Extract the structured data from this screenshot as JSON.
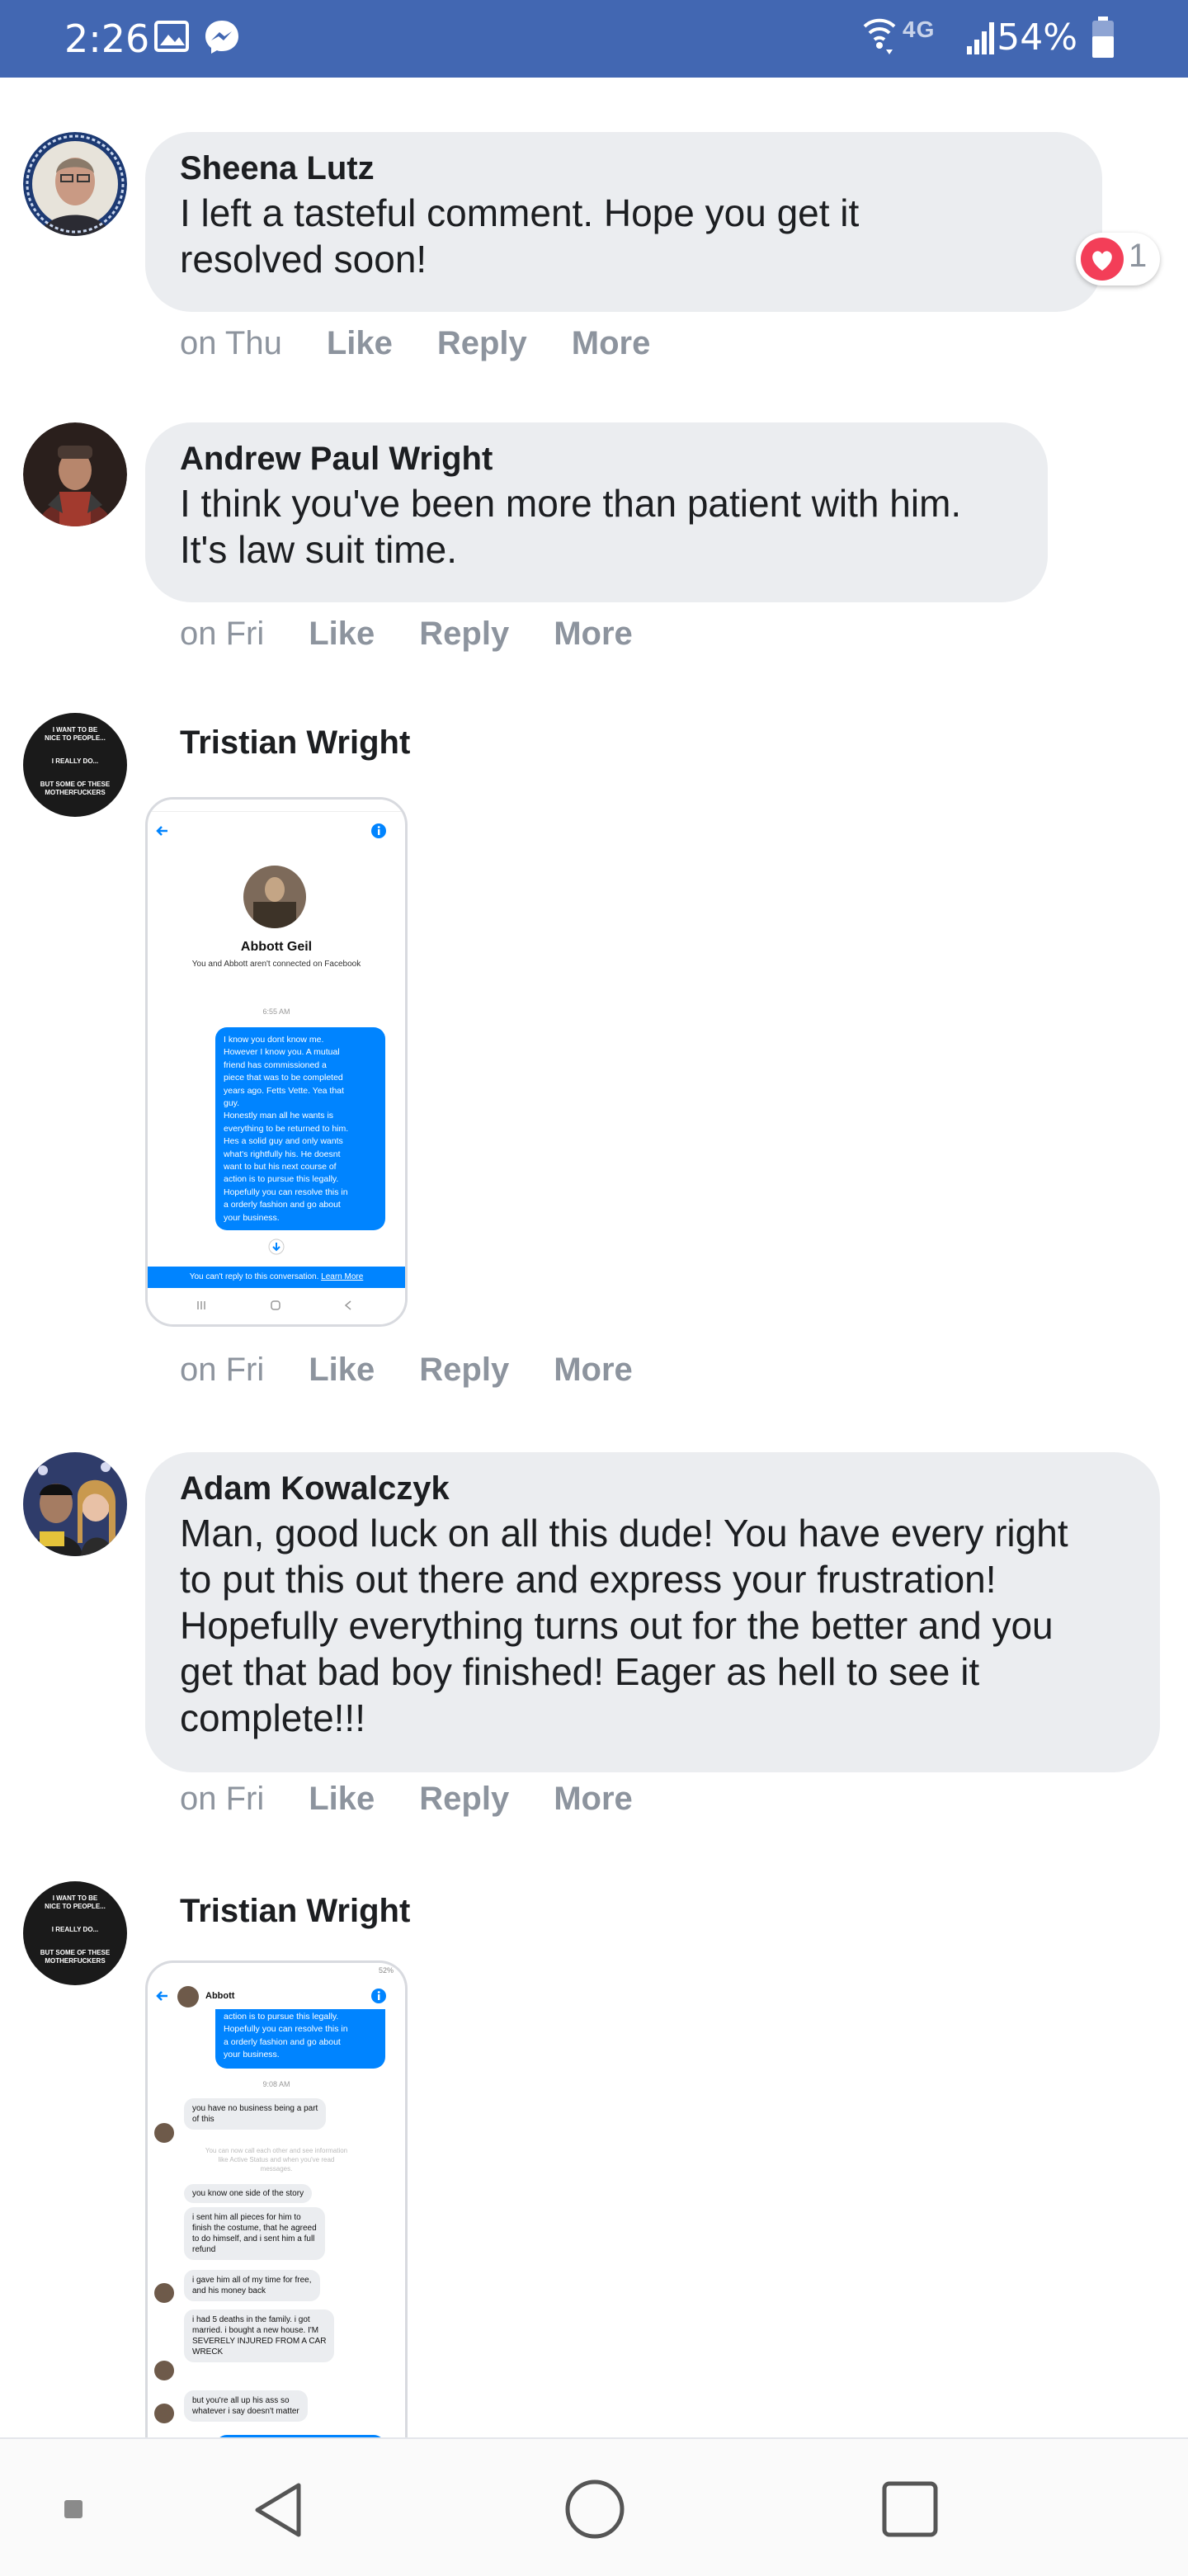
{
  "status_bar": {
    "time": "2:26",
    "network": "4G",
    "battery": "54%"
  },
  "comments": [
    {
      "name": "Sheena Lutz",
      "text": [
        "I left a tasteful comment. Hope you get it",
        "resolved soon!"
      ],
      "time": "on Thu",
      "like": "Like",
      "reply": "Reply",
      "more": "More",
      "reaction_count": "1"
    },
    {
      "name": "Andrew Paul Wright",
      "text": [
        "I think you've been more than patient with him.",
        "It's law suit time."
      ],
      "time": "on Fri",
      "like": "Like",
      "reply": "Reply",
      "more": "More"
    },
    {
      "name": "Tristian Wright",
      "time": "on Fri",
      "like": "Like",
      "reply": "Reply",
      "more": "More"
    },
    {
      "name": "Adam Kowalczyk",
      "text": [
        "Man, good luck on all this dude! You have every right",
        "to put this out there and express your frustration!",
        "Hopefully everything turns out for the better and you",
        "get that bad boy finished! Eager as hell to see it",
        "complete!!!"
      ],
      "time": "on Fri",
      "like": "Like",
      "reply": "Reply",
      "more": "More"
    },
    {
      "name": "Tristian Wright"
    }
  ],
  "avatar_text": {
    "line1": "I WANT TO BE",
    "line2": "NICE TO PEOPLE...",
    "line3": "I REALLY DO...",
    "line4": "BUT SOME OF THESE",
    "line5": "MOTHERFUCKERS"
  },
  "screenshot1": {
    "contact_name": "Abbott Geil",
    "contact_sub": "You and Abbott aren't connected on Facebook",
    "timestamp": "6:55 AM",
    "message_lines": [
      "I know you dont know me.",
      "However I know you. A mutual",
      "friend has commissioned a",
      "piece that was to be completed",
      "years ago. Fetts Vette. Yea that",
      "guy.",
      " Honestly man all he wants is",
      "everything to be returned to him.",
      "Hes a solid guy and only wants",
      "what's rightfully his. He doesnt",
      "want to but his next course of",
      "action is to pursue this legally.",
      "Hopefully you can resolve this in",
      "a orderly fashion and go about",
      "your business."
    ],
    "footer_text": "You can't reply to this conversation.",
    "footer_link": "Learn More"
  },
  "screenshot2": {
    "status_battery": "52%",
    "header_name": "Abbott",
    "top_lines": [
      "action is to pursue this legally.",
      "Hopefully you can resolve this in",
      "a orderly fashion and go about",
      "your business."
    ],
    "timestamp": "9:08 AM",
    "msg1": [
      "you have no business being a part",
      "of this"
    ],
    "notice": [
      "You can now call each other and see information",
      "like Active Status and when you've read",
      "messages."
    ],
    "msg2": [
      "you know one side of the story"
    ],
    "msg3": [
      "i sent him all pieces for him to",
      "finish the costume, that he agreed",
      "to do himself, and i sent him a full",
      "refund"
    ],
    "msg4": [
      "i gave him all of my time for free,",
      "and his money back"
    ],
    "msg5": [
      "i had 5 deaths in the family. i got",
      "married. i bought a new house. I'M",
      "SEVERELY INJURED FROM A CAR",
      "WRECK"
    ],
    "msg6": [
      "but you're all up his ass so",
      "whatever i say doesn't matter"
    ]
  },
  "colors": {
    "facebook_blue": "#4267b2",
    "bubble": "#ebedf0",
    "meta": "#8d949e",
    "messenger_blue": "#0084ff",
    "heart": "#f33e58"
  },
  "icons": [
    "image-icon",
    "messenger-icon",
    "wifi-icon",
    "signal-icon",
    "battery-icon",
    "heart-reaction-icon",
    "back-arrow-icon",
    "info-icon",
    "nav-back-icon",
    "nav-home-icon",
    "nav-recents-icon"
  ]
}
